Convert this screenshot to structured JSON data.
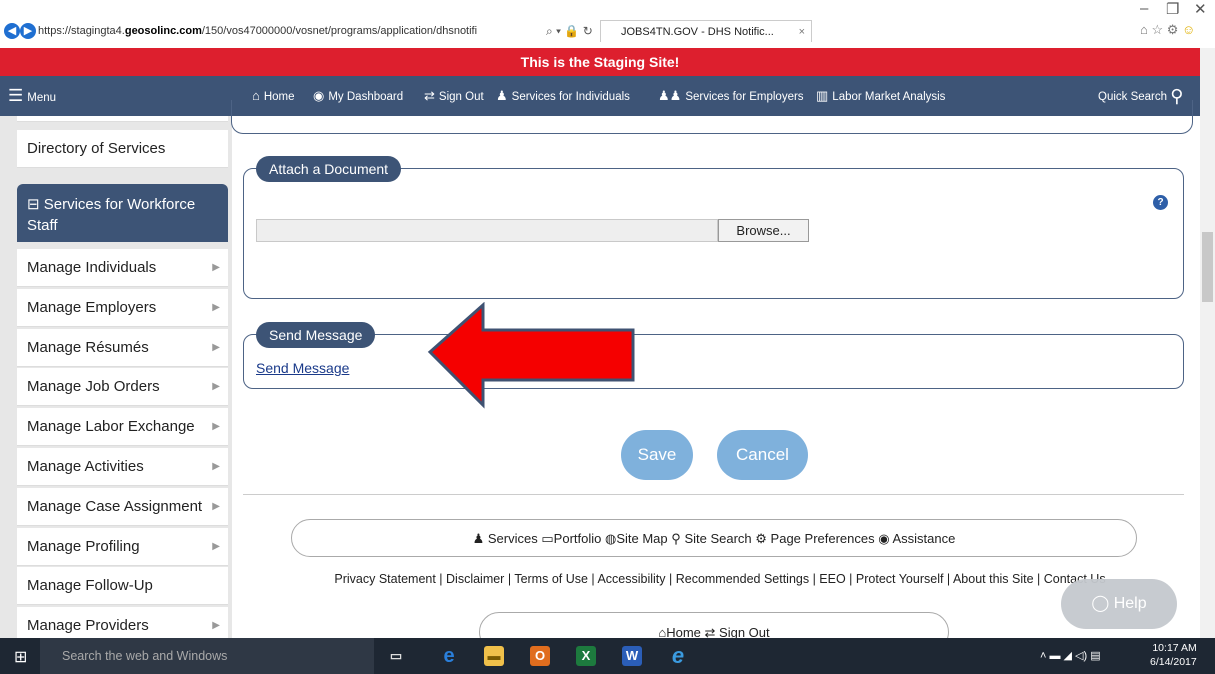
{
  "browser": {
    "url_prefix": "https://stagingta4.",
    "url_domain": "geosolinc.com",
    "url_rest": "/150/vos47000000/vosnet/programs/application/dhsnotifi",
    "tab_title": "JOBS4TN.GOV - DHS Notific...",
    "tab_close": "×"
  },
  "banner": {
    "text": "This is the Staging Site!"
  },
  "topnav": {
    "menu": "Menu",
    "home": "Home",
    "dashboard": "My Dashboard",
    "signout": "Sign Out",
    "individuals": "Services for Individuals",
    "employers": "Services for Employers",
    "lma": "Labor Market Analysis",
    "quick_search": "Quick Search"
  },
  "sidebar": {
    "directory": "Directory of Services",
    "section_toggle": "⊟",
    "section_title": "Services for Workforce Staff",
    "items": [
      "Manage Individuals",
      "Manage Employers",
      "Manage Résumés",
      "Manage Job Orders",
      "Manage Labor Exchange",
      "Manage Activities",
      "Manage Case Assignment",
      "Manage Profiling",
      "Manage Follow-Up",
      "Manage Providers"
    ]
  },
  "attach": {
    "legend": "Attach a Document",
    "browse": "Browse..."
  },
  "send": {
    "legend": "Send Message",
    "link": "Send Message"
  },
  "buttons": {
    "save": "Save",
    "cancel": "Cancel"
  },
  "footer": {
    "services": "Services",
    "portfolio": "Portfolio",
    "sitemap": "Site Map",
    "sitesearch": "Site Search",
    "prefs": "Page Preferences",
    "assistance": "Assistance",
    "legal": "Privacy Statement | Disclaimer | Terms of Use | Accessibility | Recommended Settings | EEO | Protect Yourself | About this Site | Contact Us",
    "home": "Home",
    "signout": "Sign Out"
  },
  "help": {
    "label": "Help"
  },
  "taskbar": {
    "search": "Search the web and Windows",
    "time": "10:17 AM",
    "date": "6/14/2017"
  }
}
